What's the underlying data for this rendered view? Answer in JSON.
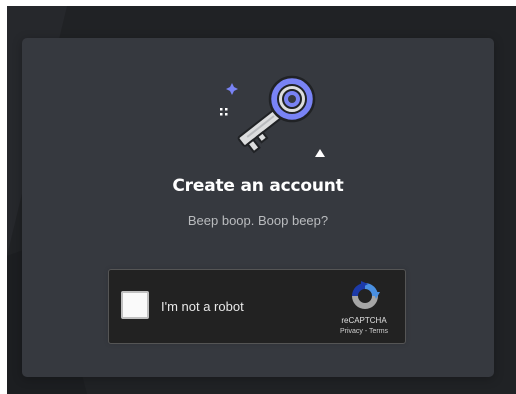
{
  "card": {
    "title": "Create an account",
    "subtitle": "Beep boop. Boop beep?"
  },
  "recaptcha": {
    "checkbox_label": "I'm not a robot",
    "checked": false,
    "brand": "reCAPTCHA",
    "privacy_label": "Privacy",
    "separator": " - ",
    "terms_label": "Terms"
  },
  "icons": {
    "illustration": "key-icon",
    "recaptcha": "recaptcha-logo-icon"
  },
  "colors": {
    "background": "#202225",
    "card": "#36393f",
    "accent": "#7983f5",
    "recaptcha_box": "#222222"
  }
}
